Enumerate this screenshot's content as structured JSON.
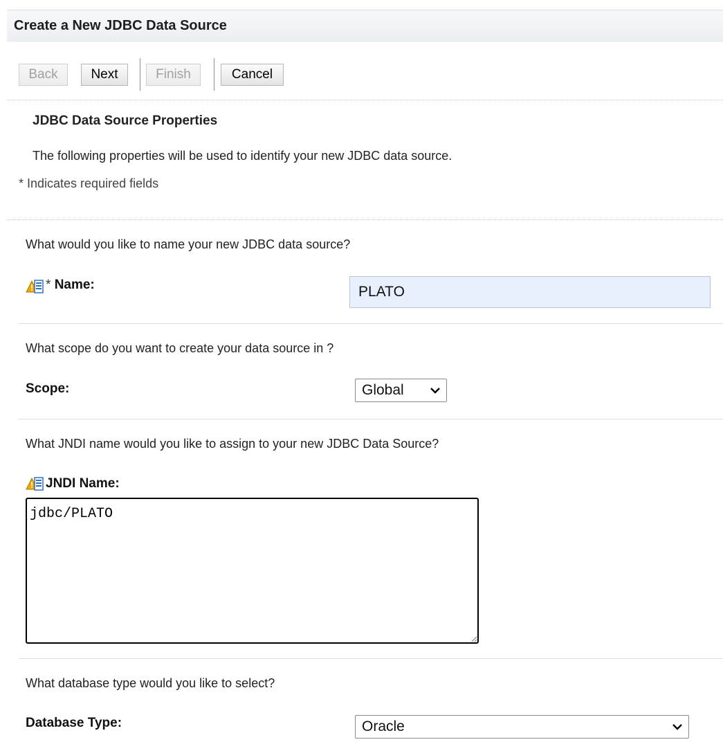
{
  "page": {
    "title": "Create a New JDBC Data Source"
  },
  "toolbar": {
    "back_label": "Back",
    "next_label": "Next",
    "finish_label": "Finish",
    "cancel_label": "Cancel"
  },
  "section": {
    "heading": "JDBC Data Source Properties",
    "description": "The following properties will be used to identify your new JDBC data source.",
    "required_note": "* Indicates required fields"
  },
  "name_field": {
    "question": "What would you like to name your new JDBC data source?",
    "required_mark": "*",
    "label": "Name:",
    "value": "PLATO"
  },
  "scope_field": {
    "question": "What scope do you want to create your data source in ?",
    "label": "Scope:",
    "selected": "Global"
  },
  "jndi_field": {
    "question": "What JNDI name would you like to assign to your new JDBC Data Source?",
    "label": "JNDI Name:",
    "value": "jdbc/PLATO"
  },
  "dbtype_field": {
    "question": "What database type would you like to select?",
    "label": "Database Type:",
    "selected": "Oracle"
  },
  "icons": {
    "field_hint": "warning-help-icon",
    "dropdown": "chevron-down-icon"
  },
  "colors": {
    "input_autofill_bg": "#e8f0fe",
    "warning_icon": "#f0a500",
    "help_icon": "#2b72c4"
  }
}
